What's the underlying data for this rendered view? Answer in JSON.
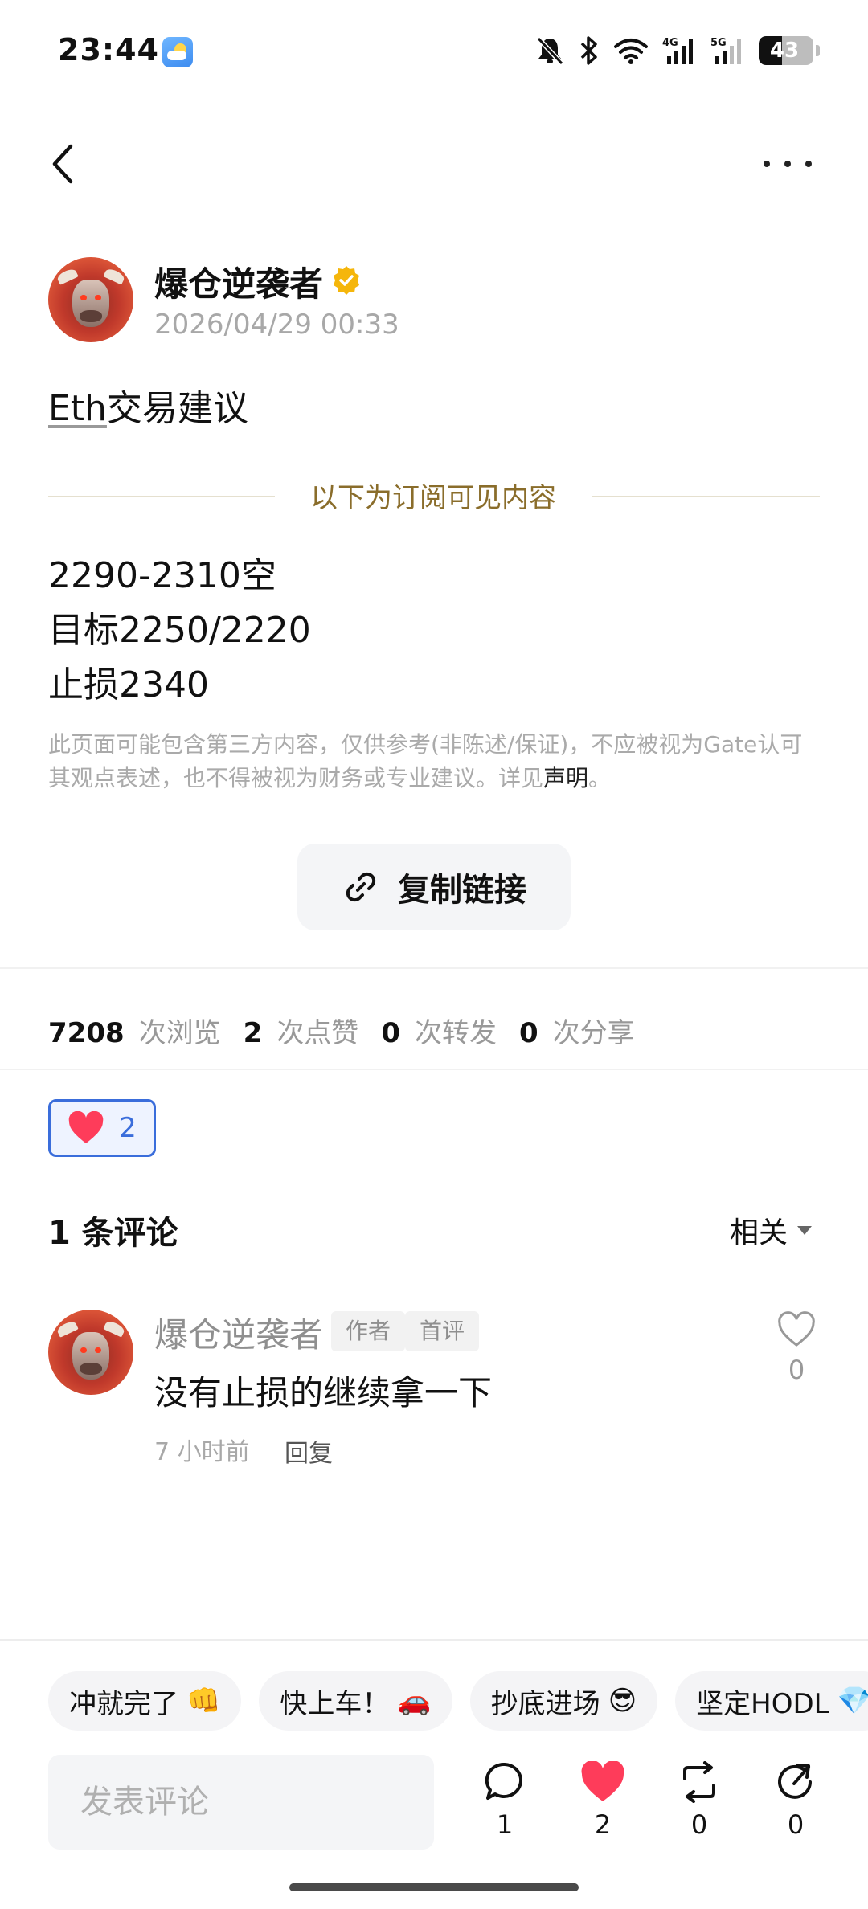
{
  "status_bar": {
    "time": "23:44",
    "battery_level": "43"
  },
  "author": {
    "name": "爆仓逆袭者",
    "post_time": "2026/04/29 00:33"
  },
  "post": {
    "title_prefix": "Eth",
    "title_rest": "交易建议",
    "subscription_label": "以下为订阅可见内容",
    "lines": [
      "2290-2310空",
      "目标2250/2220",
      "止损2340"
    ],
    "disclaimer_text": "此页面可能包含第三方内容，仅供参考(非陈述/保证)，不应被视为Gate认可其观点表述，也不得被视为财务或专业建议。详见",
    "disclaimer_link": "声明",
    "disclaimer_end": "。"
  },
  "copy_link_label": "复制链接",
  "stats": {
    "views": "7208",
    "views_label": "次浏览",
    "likes": "2",
    "likes_label": "次点赞",
    "reposts": "0",
    "reposts_label": "次转发",
    "shares": "0",
    "shares_label": "次分享"
  },
  "reaction": {
    "count": "2"
  },
  "comments": {
    "title": "1 条评论",
    "sort_label": "相关",
    "items": [
      {
        "author": "爆仓逆袭者",
        "tag_author": "作者",
        "tag_first": "首评",
        "text": "没有止损的继续拿一下",
        "time": "7 小时前",
        "reply_label": "回复",
        "like_count": "0"
      }
    ]
  },
  "quick_replies": [
    {
      "text": "冲就完了",
      "emoji": "👊"
    },
    {
      "text": "快上车！",
      "emoji": "🚗"
    },
    {
      "text": "抄底进场",
      "emoji": "😎"
    },
    {
      "text": "坚定HODL",
      "emoji": "💎"
    }
  ],
  "bottom_bar": {
    "input_placeholder": "发表评论",
    "comment_count": "1",
    "like_count": "2",
    "repost_count": "0",
    "share_count": "0"
  },
  "colors": {
    "accent_blue": "#3a6ddb",
    "like_red": "#fe3c5a",
    "gold": "#8a6d2b",
    "verified": "#f5b60b"
  }
}
